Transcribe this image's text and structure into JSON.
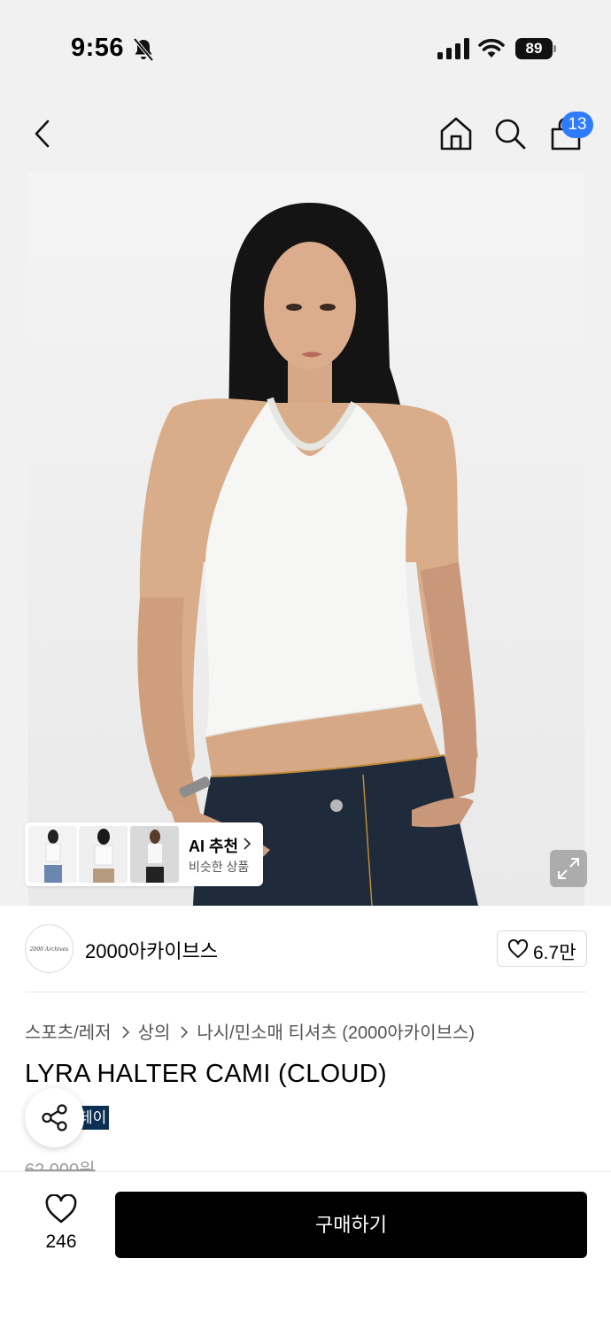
{
  "status_bar": {
    "time": "9:56",
    "battery": "89"
  },
  "header": {
    "cart_count": "13"
  },
  "ai_recommend": {
    "title": "AI 추천",
    "subtitle": "비슷한 상품"
  },
  "brand": {
    "logo_text": "2000 Archives",
    "name": "2000아카이브스",
    "like_count": "6.7만"
  },
  "breadcrumb": [
    "스포츠/레저",
    "상의",
    "나시/민소매 티셔츠 (2000아카이브스)"
  ],
  "product": {
    "title": "LYRA HALTER CAMI (CLOUD)",
    "badge": "데이",
    "original_price": "62,000원"
  },
  "bottom_bar": {
    "like_count": "246",
    "buy_label": "구매하기"
  },
  "colors": {
    "accent_blue": "#2f7bff",
    "badge_navy": "#0c2f52",
    "buy_button": "#000000"
  }
}
